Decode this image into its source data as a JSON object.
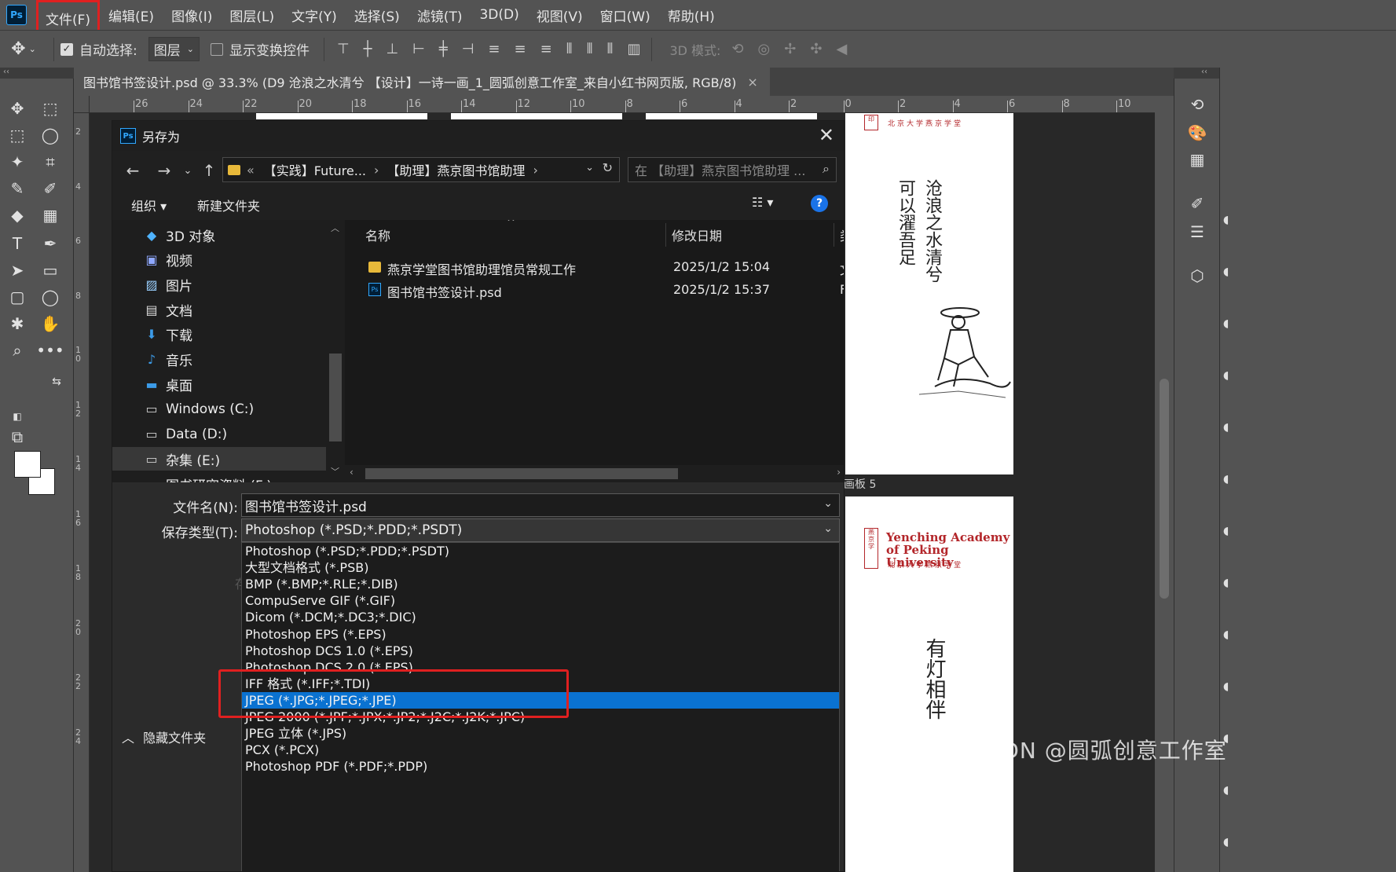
{
  "menubar": {
    "logo": "Ps",
    "items": [
      "文件(F)",
      "编辑(E)",
      "图像(I)",
      "图层(L)",
      "文字(Y)",
      "选择(S)",
      "滤镜(T)",
      "3D(D)",
      "视图(V)",
      "窗口(W)",
      "帮助(H)"
    ]
  },
  "options": {
    "auto_select_label": "自动选择:",
    "auto_select_value": "图层",
    "show_transform_label": "显示变换控件",
    "mode_3d_label": "3D 模式:"
  },
  "document": {
    "tab_title": "图书馆书签设计.psd @ 33.3% (D9 沧浪之水清兮 【设计】一诗一画_1_圆弧创意工作室_来自小红书网页版, RGB/8)",
    "tab_close": "×"
  },
  "ruler": {
    "h_labels": [
      "26",
      "24",
      "22",
      "20",
      "18",
      "16",
      "14",
      "12",
      "10",
      "8",
      "6",
      "4",
      "2",
      "0",
      "2",
      "4",
      "6",
      "8",
      "10"
    ],
    "v_labels": [
      "2",
      "4",
      "6",
      "8",
      "10",
      "12",
      "14",
      "16",
      "18",
      "20",
      "22",
      "24"
    ]
  },
  "artboards": {
    "board5_label": "画板 5",
    "bm_title_line1": "Yenching Academy",
    "bm_title_line2": "of Peking University",
    "bm_subtitle": "北京大学燕京学堂",
    "poem1_col1": "沧浪之水清兮",
    "poem1_col2": "可以濯吾足",
    "poem2": "有灯相伴"
  },
  "dialog": {
    "title": "另存为",
    "close": "✕",
    "address": {
      "prefix": "«",
      "segment1": "【实践】Future...",
      "segment2": "【助理】燕京图书馆助理"
    },
    "search_placeholder": "在 【助理】燕京图书馆助理 ...",
    "organize": "组织",
    "new_folder": "新建文件夹",
    "help": "?",
    "nav_items": [
      {
        "label": "3D 对象",
        "icon": "3d-objects-icon"
      },
      {
        "label": "视频",
        "icon": "video-icon"
      },
      {
        "label": "图片",
        "icon": "pictures-icon"
      },
      {
        "label": "文档",
        "icon": "documents-icon"
      },
      {
        "label": "下载",
        "icon": "download-icon"
      },
      {
        "label": "音乐",
        "icon": "music-icon"
      },
      {
        "label": "桌面",
        "icon": "desktop-icon"
      },
      {
        "label": "Windows (C:)",
        "icon": "drive-icon"
      },
      {
        "label": "Data (D:)",
        "icon": "drive-icon"
      },
      {
        "label": "杂集 (E:)",
        "icon": "drive-icon"
      },
      {
        "label": "图书研究资料 (F:)",
        "icon": "drive-icon"
      }
    ],
    "columns": {
      "name": "名称",
      "date": "修改日期",
      "type": "类"
    },
    "files": [
      {
        "name": "燕京学堂图书馆助理馆员常规工作",
        "date": "2025/1/2 15:04",
        "type": "文",
        "kind": "folder"
      },
      {
        "name": "图书馆书签设计.psd",
        "date": "2025/1/2 15:37",
        "type": "F",
        "kind": "psd"
      }
    ],
    "filename_label": "文件名(N):",
    "filename_value": "图书馆书签设计.psd",
    "savetype_label": "保存类型(T):",
    "savetype_value": "Photoshop (*.PSD;*.PDD;*.PSDT)",
    "ghost_label": "存",
    "format_options": [
      "Photoshop (*.PSD;*.PDD;*.PSDT)",
      "大型文档格式 (*.PSB)",
      "BMP (*.BMP;*.RLE;*.DIB)",
      "CompuServe GIF (*.GIF)",
      "Dicom (*.DCM;*.DC3;*.DIC)",
      "Photoshop EPS (*.EPS)",
      "Photoshop DCS 1.0 (*.EPS)",
      "Photoshop DCS 2.0 (*.EPS)",
      "IFF 格式 (*.IFF;*.TDI)",
      "JPEG (*.JPG;*.JPEG;*.JPE)",
      "JPEG 2000 (*.JPF;*.JPX;*.JP2;*.J2C;*.J2K;*.JPC)",
      "JPEG 立体 (*.JPS)",
      "PCX (*.PCX)",
      "Photoshop PDF (*.PDF;*.PDP)"
    ],
    "selected_format_index": 9,
    "hide_folders": "隐藏文件夹"
  },
  "watermark": "CSDN @圆弧创意工作室",
  "colors": {
    "accent_blue": "#0a72d1",
    "highlight_red": "#e02020",
    "bookmark_red": "#b3262a"
  }
}
